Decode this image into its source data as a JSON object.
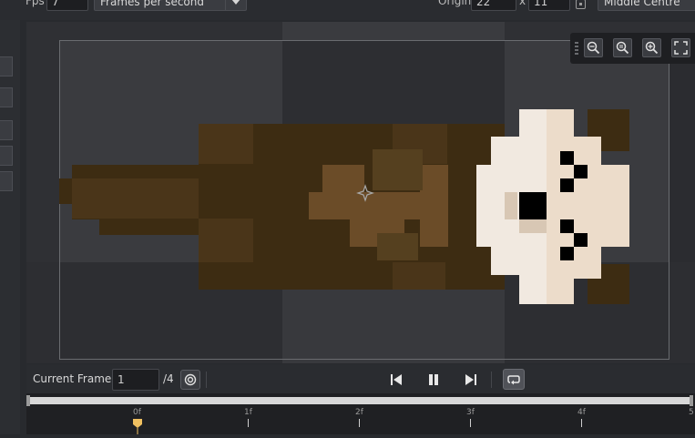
{
  "toolbar": {
    "fps_label": "Fps",
    "fps_value": "7",
    "fps_unit": "Frames per second",
    "origin_label": "Origin",
    "origin_x": "22",
    "origin_sep": "x",
    "origin_y": "11",
    "origin_preset": "Middle Centre"
  },
  "zoom": {
    "buttons": [
      "zoom-out-icon",
      "zoom-reset-icon",
      "zoom-in-icon",
      "fullscreen-icon"
    ]
  },
  "playback": {
    "current_frame_label": "Current Frame:",
    "current_frame_value": "1",
    "total_frames": "/4"
  },
  "timeline": {
    "ticks": [
      "0f",
      "1f",
      "2f",
      "3f",
      "4f",
      "5"
    ]
  },
  "colors": {
    "accent": "#f0c060",
    "fur_dark": "#3d2c12",
    "fur_mid": "#4a3519",
    "fur_light": "#6b4c28",
    "face_light": "#f1e9e0",
    "face_shade": "#ecdcca"
  }
}
